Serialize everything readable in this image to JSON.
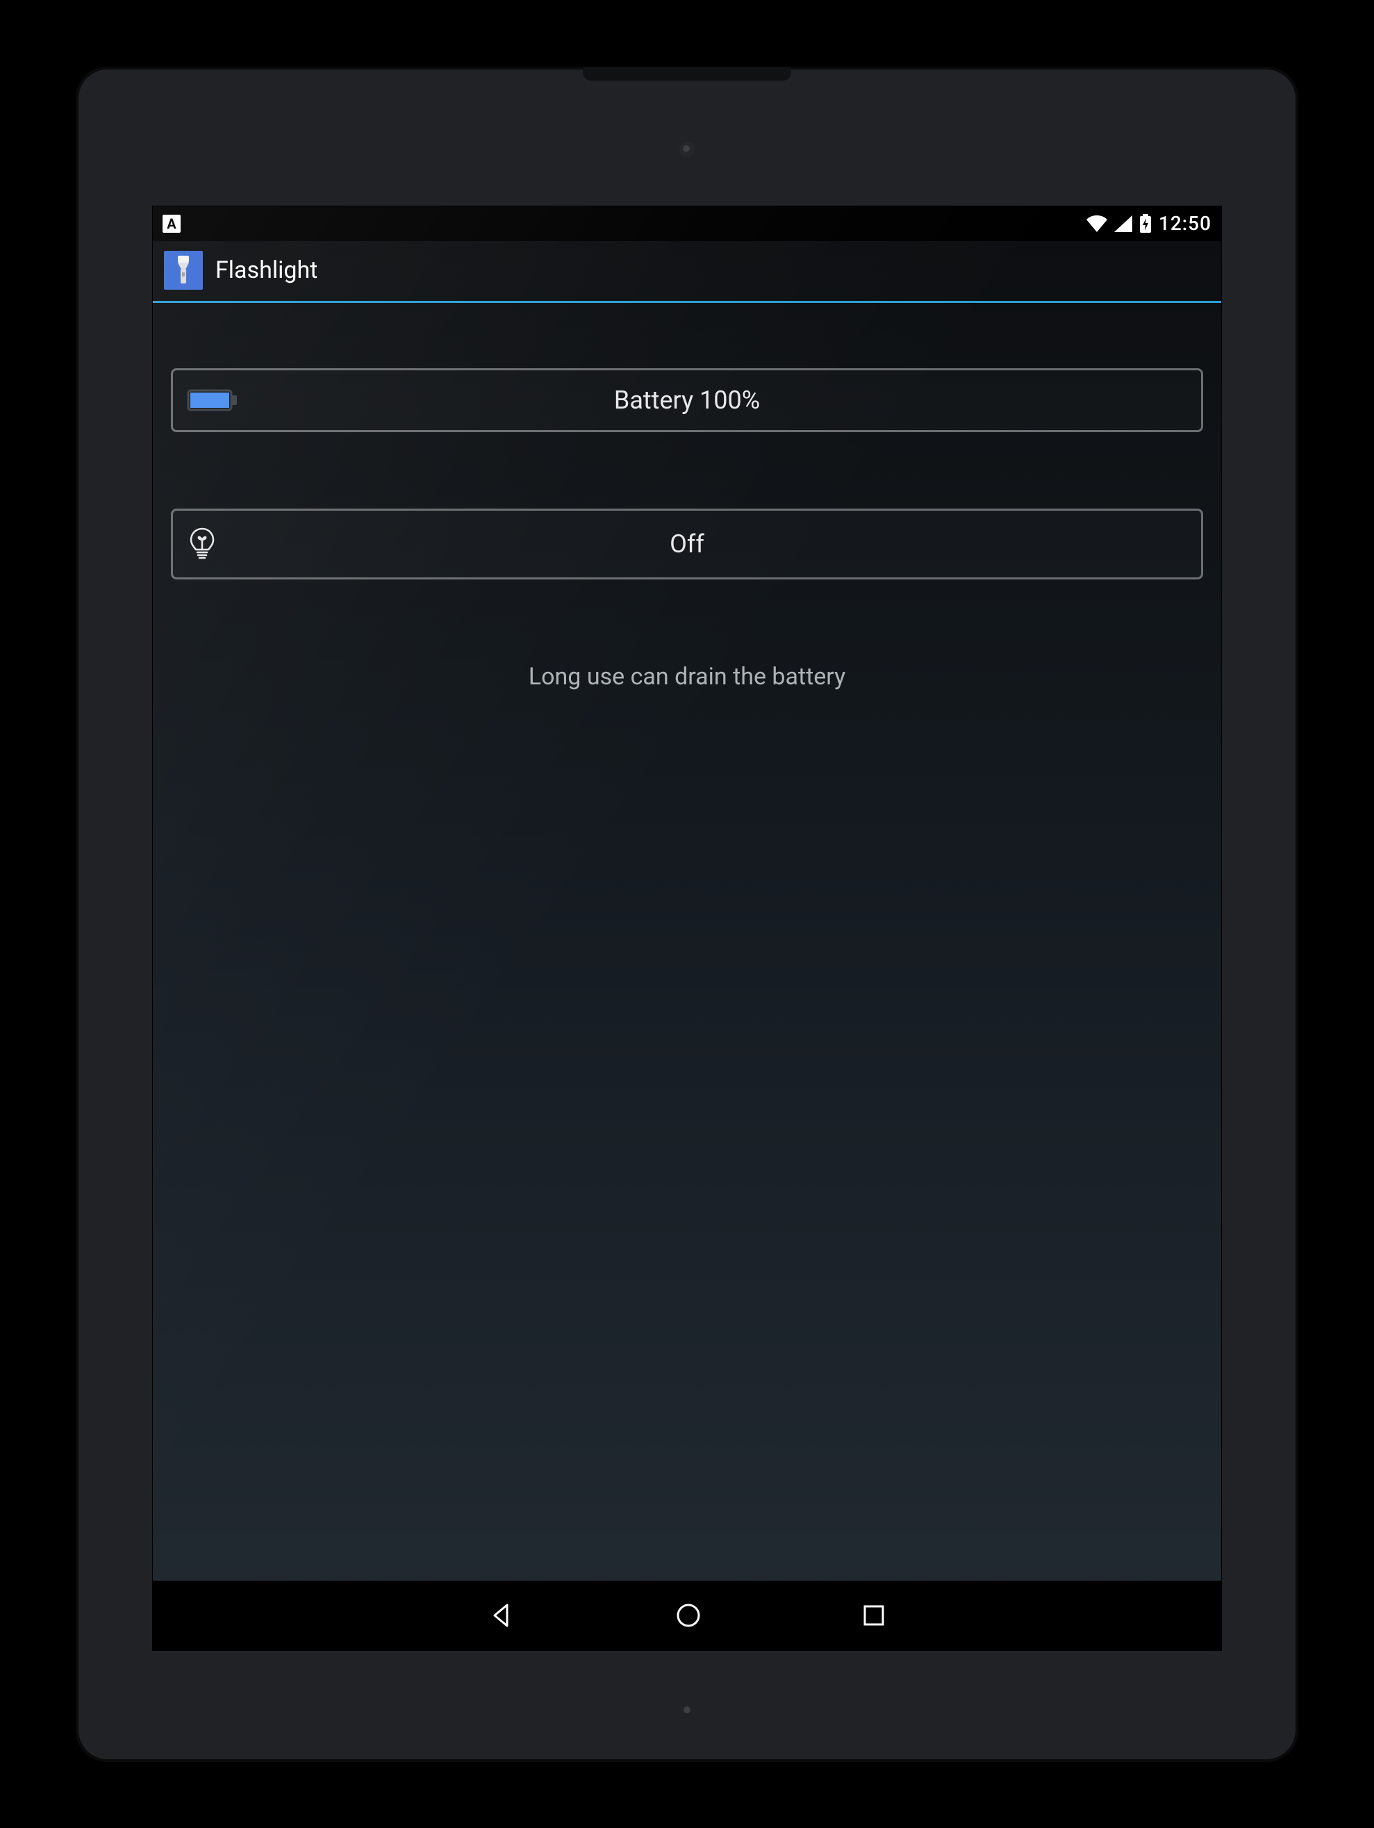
{
  "status_bar": {
    "left_badge": "A",
    "time": "12:50",
    "icons": [
      "wifi",
      "cell",
      "battery-charging"
    ]
  },
  "app_bar": {
    "title": "Flashlight",
    "icon": "flashlight"
  },
  "battery_panel": {
    "label": "Battery 100%",
    "icon": "battery"
  },
  "toggle_panel": {
    "label": "Off",
    "icon": "lightbulb"
  },
  "hint": "Long use can drain the battery",
  "nav": {
    "back": "back",
    "home": "home",
    "recents": "recents"
  }
}
